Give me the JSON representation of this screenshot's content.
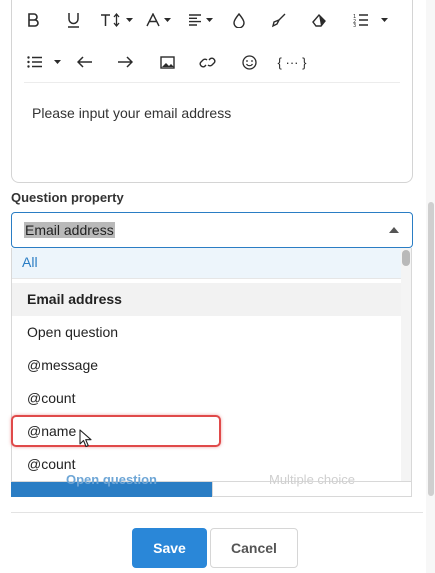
{
  "toolbar": {
    "row1": [
      "bold",
      "underline",
      "font-size",
      "font-color",
      "align",
      "fill",
      "highlight",
      "eraser",
      "ordered-list"
    ],
    "row2": [
      "bullet-list",
      "undo",
      "redo",
      "image",
      "link",
      "emoji",
      "code"
    ],
    "code_label": "{ ··· }"
  },
  "editor": {
    "content": "Please input your email address"
  },
  "question_property": {
    "label": "Question property",
    "selected": "Email address"
  },
  "dropdown": {
    "options": [
      {
        "label": "All"
      },
      {
        "label": "Email address"
      },
      {
        "label": "Open question"
      },
      {
        "label": "@message"
      },
      {
        "label": "@count"
      },
      {
        "label": "@name"
      },
      {
        "label": "@count"
      }
    ]
  },
  "segmented": {
    "left": "Open question",
    "right": "Multiple choice"
  },
  "buttons": {
    "save": "Save",
    "cancel": "Cancel"
  },
  "colors": {
    "accent": "#2a7dc4",
    "highlight_border": "#e04a4a"
  }
}
